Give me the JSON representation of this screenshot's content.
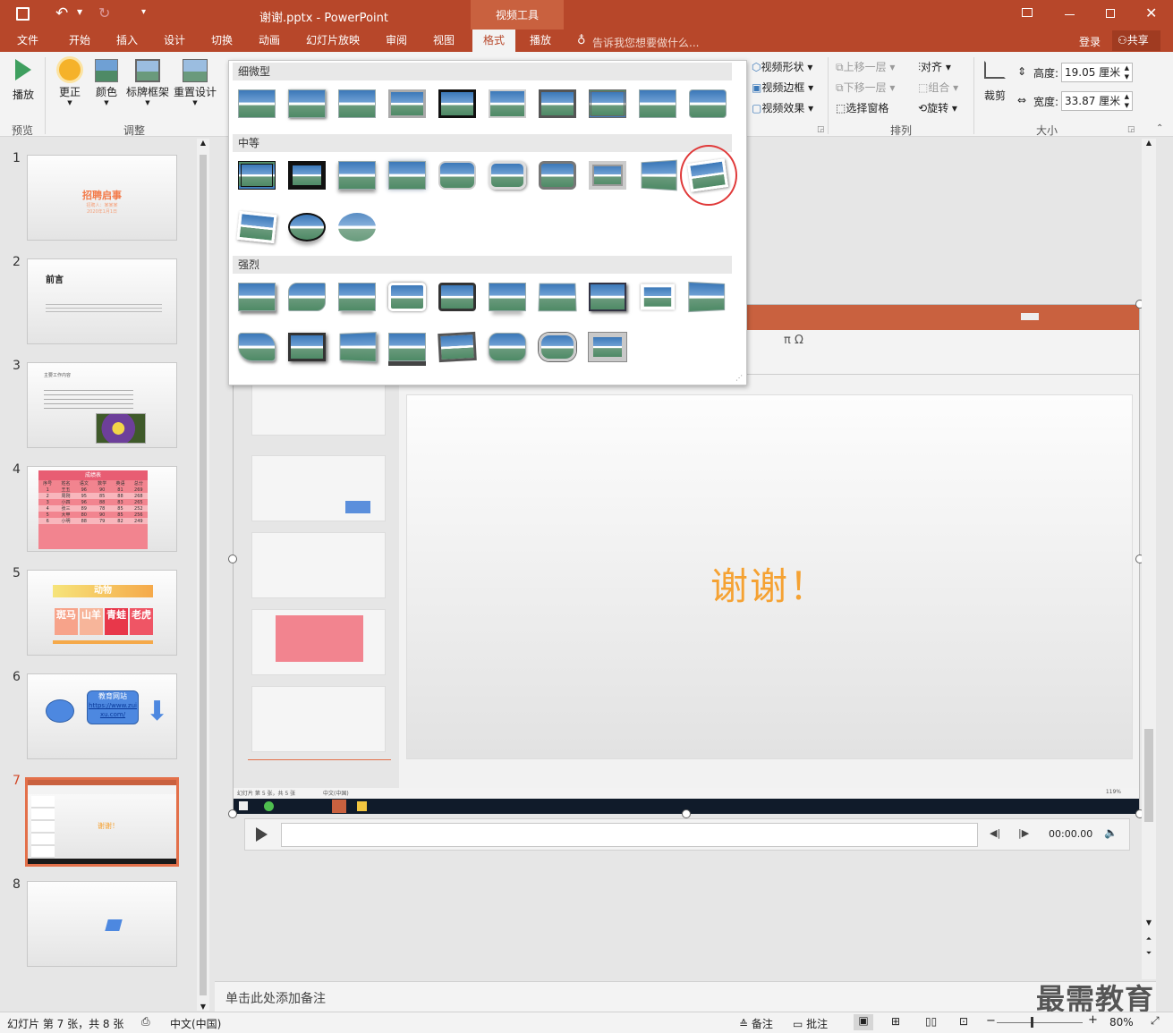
{
  "window": {
    "title": "谢谢.pptx - PowerPoint",
    "contextual": "视频工具",
    "login": "登录",
    "share": "共享"
  },
  "tabs": [
    "文件",
    "开始",
    "插入",
    "设计",
    "切换",
    "动画",
    "幻灯片放映",
    "审阅",
    "视图",
    "格式",
    "播放"
  ],
  "active_tab": "格式",
  "tell_me": "告诉我您想要做什么...",
  "ribbon": {
    "play": "播放",
    "preview_group": "预览",
    "correct": "更正",
    "color": "颜色",
    "poster": "标牌框架",
    "reset": "重置设计",
    "adjust_group": "调整",
    "shape": "视频形状",
    "border": "视频边框",
    "effects": "视频效果",
    "bring_forward": "上移一层",
    "send_backward": "下移一层",
    "selection_pane": "选择窗格",
    "align": "对齐",
    "group": "组合",
    "rotate": "旋转",
    "arrange_group": "排列",
    "crop": "裁剪",
    "height_label": "高度:",
    "height_value": "19.05 厘米",
    "width_label": "宽度:",
    "width_value": "33.87 厘米",
    "size_group": "大小"
  },
  "gallery": {
    "section_subtle": "细微型",
    "section_moderate": "中等",
    "section_intense": "强烈"
  },
  "slides": [
    {
      "num": "1",
      "title": "招聘启事",
      "sub": "招聘人：某某某",
      "date": "2020年1月1日"
    },
    {
      "num": "2",
      "title": "前言"
    },
    {
      "num": "3",
      "title": "主要工作内容"
    },
    {
      "num": "4",
      "title": "成绩表",
      "headers": [
        "序号",
        "姓名",
        "语文",
        "数学",
        "英语",
        "总分"
      ],
      "rows": [
        [
          "1",
          "王五",
          "96",
          "90",
          "81",
          "269"
        ],
        [
          "2",
          "周刚",
          "95",
          "85",
          "88",
          "268"
        ],
        [
          "3",
          "小四",
          "96",
          "88",
          "83",
          "265"
        ],
        [
          "4",
          "张三",
          "89",
          "78",
          "85",
          "252"
        ],
        [
          "5",
          "大甲",
          "80",
          "90",
          "85",
          "256"
        ],
        [
          "6",
          "小明",
          "88",
          "79",
          "82",
          "249"
        ]
      ]
    },
    {
      "num": "5",
      "title": "动物",
      "tiles": [
        "斑马",
        "山羊",
        "青蛙",
        "老虎"
      ]
    },
    {
      "num": "6",
      "bubble": "教育网站",
      "link": "https://www.zuixu.com/"
    },
    {
      "num": "7",
      "text": "谢谢！"
    },
    {
      "num": "8"
    }
  ],
  "video": {
    "thanks": "谢谢！",
    "time": "00:00.00",
    "inner_status": "幻灯片 第 5 张，共 5 张",
    "inner_lang": "中文(中国)",
    "inner_zoom": "119%"
  },
  "notes_placeholder": "单击此处添加备注",
  "status": {
    "slide_info": "幻灯片 第 7 张，共 8 张",
    "lang": "中文(中国)",
    "notes": "备注",
    "comments": "批注",
    "zoom": "80%"
  },
  "watermark": "最需教育",
  "colors": {
    "accent": "#b7472a",
    "highlight_circle": "#e03a3a",
    "thanks_orange": "#f5a233"
  }
}
